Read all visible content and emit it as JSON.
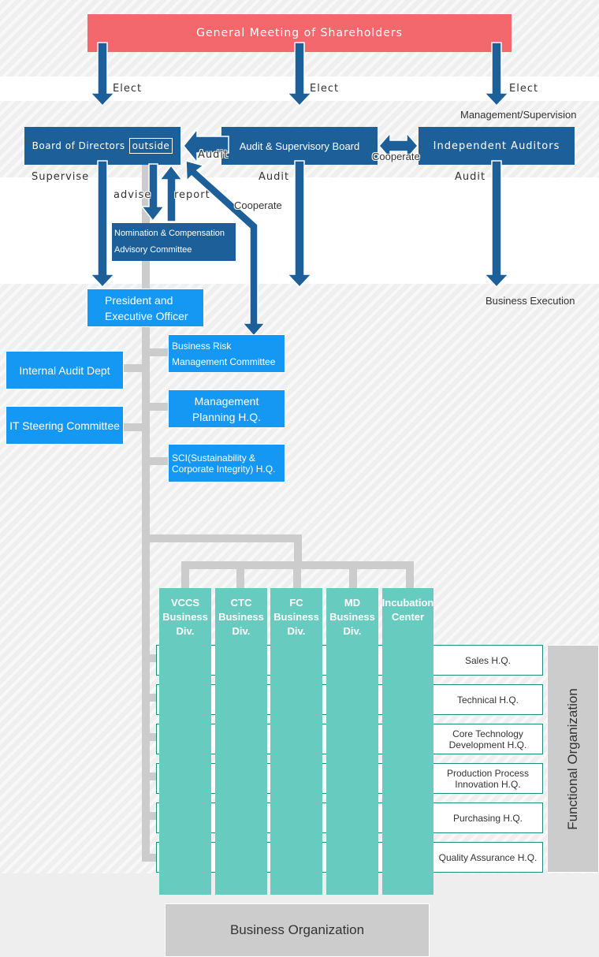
{
  "governance": {
    "shareholders": "General Meeting of Shareholders",
    "board": "Board of Directors",
    "board_tag": "outside",
    "audit_board": "Audit & Supervisory Board",
    "independent_auditors": "Independent Auditors",
    "nomination_committee_line1": "Nomination & Compensation",
    "nomination_committee_line2": "Advisory Committee"
  },
  "relations": {
    "elect_1": "Elect",
    "elect_2": "Elect",
    "elect_3": "Elect",
    "management_supervision": "Management/Supervision",
    "audit_to_board": "Audit",
    "cooperate_auditors": "Cooperate",
    "supervise": "Supervise",
    "audit_2": "Audit",
    "audit_3": "Audit",
    "advise": "advise",
    "report": "report",
    "cooperate_risk": "Cooperate",
    "business_execution": "Business Execution"
  },
  "executive": {
    "president_line1": "President and",
    "president_line2": "Executive Officer",
    "internal_audit": "Internal Audit Dept",
    "it_steering": "IT Steering Committee",
    "risk_line1": "Business Risk",
    "risk_line2": "Management Committee",
    "planning_line1": "Management",
    "planning_line2": "Planning H.Q.",
    "sci_line1": "SCI(Sustainability &",
    "sci_line2": "Corporate Integrity) H.Q."
  },
  "business_divisions": [
    {
      "line1": "VCCS",
      "line2": "Business",
      "line3": "Div."
    },
    {
      "line1": "CTC",
      "line2": "Business",
      "line3": "Div."
    },
    {
      "line1": "FC",
      "line2": "Business",
      "line3": "Div."
    },
    {
      "line1": "MD",
      "line2": "Business",
      "line3": "Div."
    },
    {
      "line1": "Incubation",
      "line2": "Center",
      "line3": ""
    }
  ],
  "functional_units": [
    {
      "line1": "Sales H.Q.",
      "line2": ""
    },
    {
      "line1": "Technical H.Q.",
      "line2": ""
    },
    {
      "line1": "Core Technology",
      "line2": "Development H.Q."
    },
    {
      "line1": "Production Process",
      "line2": "Innovation H.Q."
    },
    {
      "line1": "Purchasing H.Q.",
      "line2": ""
    },
    {
      "line1": "Quality Assurance H.Q.",
      "line2": ""
    }
  ],
  "labels": {
    "functional_organization": "Functional Organization",
    "business_organization": "Business Organization"
  },
  "colors": {
    "shareholders": "#f2686c",
    "governance": "#1d5f98",
    "executive": "#1598f4",
    "business_division": "#67cbbf",
    "functional_border": "#1b8a7f",
    "connector": "#cccccc"
  }
}
